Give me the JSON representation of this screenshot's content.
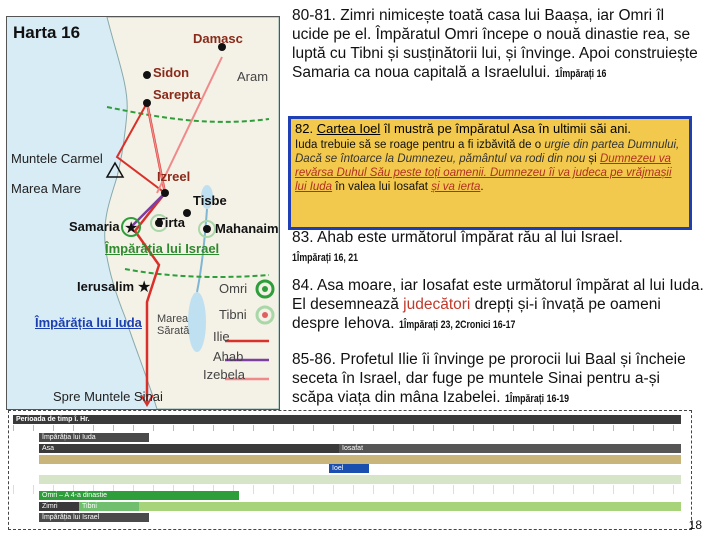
{
  "map": {
    "title": "Harta 16",
    "places": {
      "damasc": "Damasc",
      "sidon": "Sidon",
      "aram": "Aram",
      "sarepta": "Sarepta",
      "carmel": "Muntele Carmel",
      "izreel": "Izreel",
      "sea": "Marea Mare",
      "tisbe": "Tisbe",
      "samaria": "Samaria",
      "tirta": "Tirta",
      "mahanaim": "Mahanaim",
      "israel_kingdom": "Împărăția lui Israel",
      "ierusalim": "Ierusalim",
      "juda_kingdom": "Împărăția lui Iuda",
      "dead_sea": "Marea Sărată",
      "sinai": "Spre Muntele Sinai"
    },
    "legend": {
      "omri": "Omri",
      "tibni": "Tibni",
      "ilie": "Ilie",
      "ahab": "Ahab",
      "izebela": "Izebela"
    },
    "colors": {
      "ilie": "#d9302a",
      "ahab": "#7b3f9e",
      "izebela": "#f08a8a",
      "omri": "#2e9e3a",
      "tibni": "#a8d8a8"
    }
  },
  "p80": {
    "text": "80-81. Zimri nimicește toată casa lui Baașa, iar Omri îl ucide pe el. Împăratul Omri începe o nouă dinastie rea, se luptă cu Tibni și susținătorii lui, și învinge. Apoi construiește Samaria ca noua capitală a Israelului.",
    "ref": "1Împărați 16"
  },
  "p82": {
    "num": "82.",
    "title": "Cartea Ioel",
    "intro": " îl mustră pe împăratul Asa în ultimii săi ani.",
    "body1": "Iuda trebuie să se roage pentru a fi izbăvită de o ",
    "body2": "urgie din partea Dumnului, Dacă se întoarce la Dumnezeu, pământul va rodi din nou",
    "body3": " și ",
    "body4": "Dumnezeu va revărsa Duhul Său peste toți oamenii. Dumnezeu îi va judeca pe vrăjmașii lui Iuda",
    "body5": " în valea lui Iosafat ",
    "body6": "și va ierta",
    "body7": "."
  },
  "p83": {
    "text": "83. Ahab este următorul împărat rău al lui Israel.",
    "ref": "1Împărați 16, 21"
  },
  "p84": {
    "text1": "84. Asa moare, iar Iosafat este următorul împărat al lui Iuda. El desemnează ",
    "highlight": "judecători",
    "text2": " drepți și-i învață pe oameni despre Iehova.",
    "ref": "1Împărați 23, 2Cronici 16-17"
  },
  "p85": {
    "text": "85-86. Profetul Ilie îi învinge pe prorocii lui Baal și încheie seceta în Israel, dar fuge pe muntele Sinai pentru a-și scăpa viața din mâna Izabelei.",
    "ref": "1Împărați 16-19"
  },
  "timeline": {
    "header": "Perioada de timp î. Hr.",
    "juda_label": "Împărăția lui Iuda",
    "asa": "Asa",
    "iosafat": "Iosafat",
    "ioel": "Ioel",
    "omri_dyn": "Omri – A 4-a dinastie",
    "tibni": "Tibni",
    "zimri": "Zimri",
    "israel_label": "Împărăția lui Israel"
  },
  "page_number": "18"
}
